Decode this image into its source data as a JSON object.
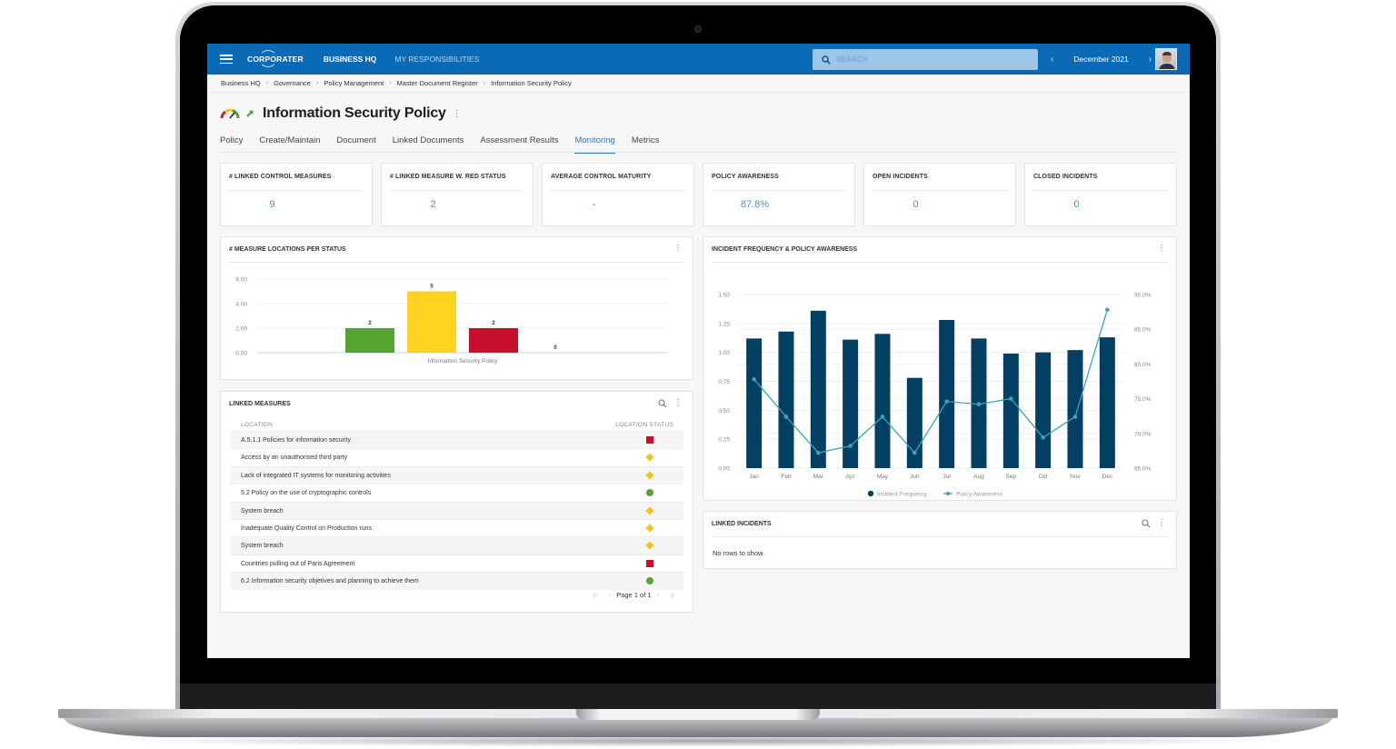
{
  "topbar": {
    "brand": "CORPORATER",
    "nav": [
      "BUSINESS HQ",
      "MY RESPONSIBILITIES"
    ],
    "search_placeholder": "SEARCH",
    "period": "December 2021"
  },
  "breadcrumb": [
    "Business HQ",
    "Governance",
    "Policy Management",
    "Master Document Register",
    "Information Security Policy"
  ],
  "page": {
    "title": "Information Security Policy",
    "tabs": [
      "Policy",
      "Create/Maintain",
      "Document",
      "Linked Documents",
      "Assessment Results",
      "Monitoring",
      "Metrics"
    ],
    "active_tab": "Monitoring"
  },
  "kpis": [
    {
      "title": "# LINKED CONTROL MEASURES",
      "value": "9"
    },
    {
      "title": "# LINKED MEASURE W. RED STATUS",
      "value": "2"
    },
    {
      "title": "AVERAGE CONTROL MATURITY",
      "value": "-"
    },
    {
      "title": "POLICY AWARENESS",
      "value": "87.8%"
    },
    {
      "title": "OPEN INCIDENTS",
      "value": "0"
    },
    {
      "title": "CLOSED INCIDENTS",
      "value": "0"
    }
  ],
  "colors": {
    "brand": "#0a6ab5",
    "accent": "#2e79b4",
    "status_green": "#56a532",
    "status_yellow": "#fdd31f",
    "status_red": "#c8102e",
    "bar_navy": "#033f63",
    "line_teal": "#3ea3b3"
  },
  "chart_data": [
    {
      "type": "bar",
      "title": "# MEASURE LOCATIONS PER STATUS",
      "categories": [
        "Information Security Policy"
      ],
      "series": [
        {
          "name": "Green",
          "values": [
            2
          ],
          "color": "#56a532"
        },
        {
          "name": "Yellow",
          "values": [
            5
          ],
          "color": "#fdd31f"
        },
        {
          "name": "Red",
          "values": [
            2
          ],
          "color": "#c8102e"
        },
        {
          "name": "None",
          "values": [
            0
          ],
          "color": "#999999"
        }
      ],
      "yticks": [
        "0.00",
        "2.00",
        "4.00",
        "6.00"
      ],
      "ylim": [
        0,
        6
      ],
      "grid": true,
      "xlabel": "Information Security Policy"
    },
    {
      "type": "bar",
      "title": "INCIDENT FREQUENCY & POLICY AWARENESS",
      "categories": [
        "Jan",
        "Feb",
        "Mar",
        "Apr",
        "May",
        "Jun",
        "Jul",
        "Aug",
        "Sep",
        "Oct",
        "Nov",
        "Dec"
      ],
      "series": [
        {
          "name": "Incident Frequency",
          "type": "bar",
          "axis": "left",
          "values": [
            1.12,
            1.18,
            1.36,
            1.11,
            1.16,
            0.78,
            1.28,
            1.12,
            0.99,
            1.0,
            1.02,
            1.13
          ]
        },
        {
          "name": "Policy Awareness",
          "type": "line",
          "axis": "right",
          "values": [
            77.8,
            72.4,
            67.2,
            68.2,
            72.4,
            67.2,
            74.6,
            74.2,
            75.0,
            69.4,
            72.4,
            87.8
          ]
        }
      ],
      "ylim_left": [
        0,
        1.5
      ],
      "yticks_left": [
        "0.00",
        "0.25",
        "0.50",
        "0.75",
        "1.00",
        "1.25",
        "1.50"
      ],
      "ylim_right": [
        65,
        90
      ],
      "yticks_right": [
        "65.0%",
        "70.0%",
        "75.0%",
        "80.0%",
        "85.0%",
        "90.0%"
      ],
      "grid": true,
      "legend": "bottom"
    }
  ],
  "linked_measures": {
    "title": "LINKED MEASURES",
    "columns": [
      "LOCATION",
      "LOCATION STATUS"
    ],
    "rows": [
      {
        "location": "A.5.1.1 Policies for information security",
        "status": "red"
      },
      {
        "location": "Access by an unauthorised third party",
        "status": "yellow"
      },
      {
        "location": "Lack of integrated IT systems for monitoring activities",
        "status": "yellow"
      },
      {
        "location": "5.2 Policy on the use of cryptographic controls",
        "status": "green"
      },
      {
        "location": "System breach",
        "status": "yellow"
      },
      {
        "location": "Inadequate Quality Control on Production runs",
        "status": "yellow"
      },
      {
        "location": "System breach",
        "status": "yellow"
      },
      {
        "location": "Countries pulling out of Paris Agreement",
        "status": "red"
      },
      {
        "location": "6.2 Information security objetives and planning to achieve them",
        "status": "green"
      }
    ],
    "pager": "Page 1 of 1"
  },
  "linked_incidents": {
    "title": "LINKED INCIDENTS",
    "empty": "No rows to show."
  }
}
